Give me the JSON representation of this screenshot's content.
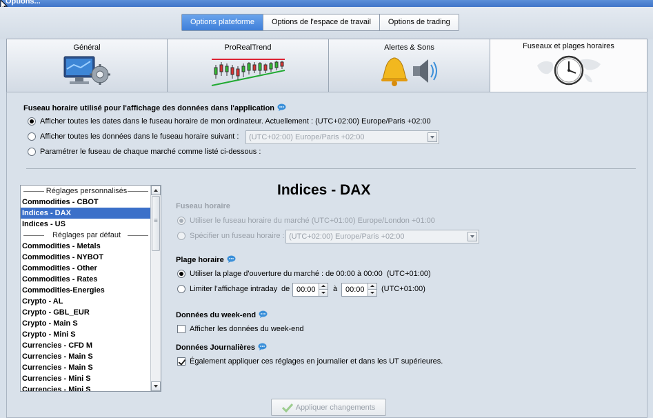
{
  "window": {
    "title": "Options..."
  },
  "segments": [
    {
      "label": "Options plateforme",
      "active": true
    },
    {
      "label": "Options de l'espace de travail",
      "active": false
    },
    {
      "label": "Options de trading",
      "active": false
    }
  ],
  "tabs": [
    {
      "label": "Général",
      "icon": "monitor-gear-icon"
    },
    {
      "label": "ProRealTrend",
      "icon": "candlestick-trend-icon"
    },
    {
      "label": "Alertes & Sons",
      "icon": "bell-speaker-icon"
    },
    {
      "label": "Fuseaux et plages horaires",
      "icon": "world-clock-icon",
      "active": true
    }
  ],
  "timezone": {
    "title": "Fuseau horaire utilisé pour l'affichage des données dans l'application",
    "option1": "Afficher toutes les dates dans le fuseau horaire de mon ordinateur. Actuellement : (UTC+02:00) Europe/Paris +02:00",
    "option2": "Afficher toutes les données dans le fuseau horaire suivant :",
    "option2_combo": "(UTC+02:00) Europe/Paris +02:00",
    "option3": "Paramétrer le fuseau de chaque marché comme listé ci-dessous :",
    "selected": 1
  },
  "list": {
    "items": [
      {
        "label": "Réglages personnalisés",
        "type": "header"
      },
      {
        "label": "Commodities - CBOT"
      },
      {
        "label": "Indices - DAX",
        "selected": true
      },
      {
        "label": "Indices - US"
      },
      {
        "label": "Réglages par défaut",
        "type": "header"
      },
      {
        "label": "Commodities - Metals"
      },
      {
        "label": "Commodities - NYBOT"
      },
      {
        "label": "Commodities - Other"
      },
      {
        "label": "Commodities - Rates"
      },
      {
        "label": "Commodities-Energies"
      },
      {
        "label": "Crypto - AL"
      },
      {
        "label": "Crypto - GBL_EUR"
      },
      {
        "label": "Crypto - Main S"
      },
      {
        "label": "Crypto - Mini S"
      },
      {
        "label": "Currencies - CFD M"
      },
      {
        "label": "Currencies - Main S"
      },
      {
        "label": "Currencies - Main S"
      },
      {
        "label": "Currencies - Mini S"
      },
      {
        "label": "Currencies - Mini S"
      }
    ]
  },
  "detail": {
    "title": "Indices - DAX",
    "fuseau_title": "Fuseau horaire",
    "fuseau_opt1": "Utiliser le fuseau horaire du marché (UTC+01:00) Europe/London +01:00",
    "fuseau_opt2": "Spécifier un fuseau horaire :",
    "fuseau_combo": "(UTC+02:00) Europe/Paris +02:00",
    "plage_title": "Plage horaire",
    "plage_opt1": "Utiliser la plage d'ouverture du marché : de 00:00 à 00:00  (UTC+01:00)",
    "plage_opt2": "Limiter l'affichage intraday",
    "plage_de": "de",
    "plage_from": "00:00",
    "plage_a": "à",
    "plage_to": "00:00",
    "plage_tz": "(UTC+01:00)",
    "weekend_title": "Données du week-end",
    "weekend_check": "Afficher les données du week-end",
    "journ_title": "Données Journalières",
    "journ_check": "Également appliquer ces réglages en journalier et dans les UT supérieures."
  },
  "apply_button": "Appliquer changements",
  "colors": {
    "accent": "#3f7fd9",
    "selection": "#3b70c9",
    "info": "#3a8fd9"
  }
}
